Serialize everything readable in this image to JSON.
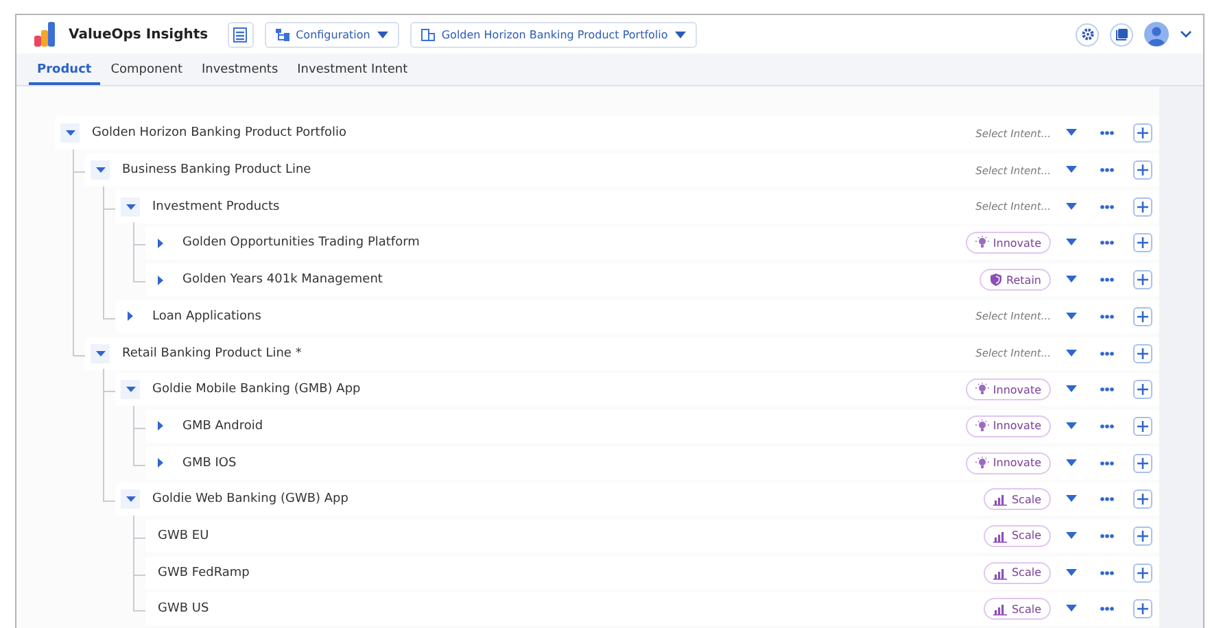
{
  "header": {
    "app_name": "ValueOps Insights",
    "configuration": "Configuration",
    "portfolio": "Golden Horizon Banking Product Portfolio"
  },
  "tabs": [
    {
      "label": "Product",
      "selected": true
    },
    {
      "label": "Component",
      "selected": false
    },
    {
      "label": "Investments",
      "selected": false
    },
    {
      "label": "Investment Intent",
      "selected": false
    }
  ],
  "tree": [
    {
      "name": "Golden Horizon Banking Product Portfolio",
      "kind": "branch",
      "expanded": true,
      "intent": {
        "placeholder": "Select Intent..."
      },
      "children": [
        {
          "name": "Business Banking Product Line",
          "kind": "branch",
          "expanded": true,
          "intent": {
            "placeholder": "Select Intent..."
          },
          "children": [
            {
              "name": "Investment Products",
              "kind": "branch",
              "expanded": true,
              "intent": {
                "placeholder": "Select Intent..."
              },
              "children": [
                {
                  "name": "Golden Opportunities Trading Platform",
                  "kind": "branch",
                  "expanded": false,
                  "intent": {
                    "label": "Innovate",
                    "kind": "innovate"
                  }
                },
                {
                  "name": "Golden Years 401k Management",
                  "kind": "branch",
                  "expanded": false,
                  "intent": {
                    "label": "Retain",
                    "kind": "retain"
                  }
                }
              ]
            },
            {
              "name": "Loan Applications",
              "kind": "branch",
              "expanded": false,
              "intent": {
                "placeholder": "Select Intent..."
              }
            }
          ]
        },
        {
          "name": "Retail Banking Product Line *",
          "kind": "branch",
          "expanded": true,
          "intent": {
            "placeholder": "Select Intent..."
          },
          "children": [
            {
              "name": "Goldie Mobile Banking (GMB) App",
              "kind": "branch",
              "expanded": true,
              "intent": {
                "label": "Innovate",
                "kind": "innovate"
              },
              "children": [
                {
                  "name": "GMB Android",
                  "kind": "branch",
                  "expanded": false,
                  "intent": {
                    "label": "Innovate",
                    "kind": "innovate"
                  }
                },
                {
                  "name": "GMB IOS",
                  "kind": "branch",
                  "expanded": false,
                  "intent": {
                    "label": "Innovate",
                    "kind": "innovate"
                  }
                }
              ]
            },
            {
              "name": "Goldie Web Banking (GWB) App",
              "kind": "branch",
              "expanded": true,
              "intent": {
                "label": "Scale",
                "kind": "scale"
              },
              "children": [
                {
                  "name": "GWB EU",
                  "kind": "leaf",
                  "intent": {
                    "label": "Scale",
                    "kind": "scale"
                  }
                },
                {
                  "name": "GWB FedRamp",
                  "kind": "leaf",
                  "intent": {
                    "label": "Scale",
                    "kind": "scale"
                  }
                },
                {
                  "name": "GWB US",
                  "kind": "leaf",
                  "intent": {
                    "label": "Scale",
                    "kind": "scale"
                  }
                }
              ]
            }
          ]
        }
      ]
    }
  ]
}
